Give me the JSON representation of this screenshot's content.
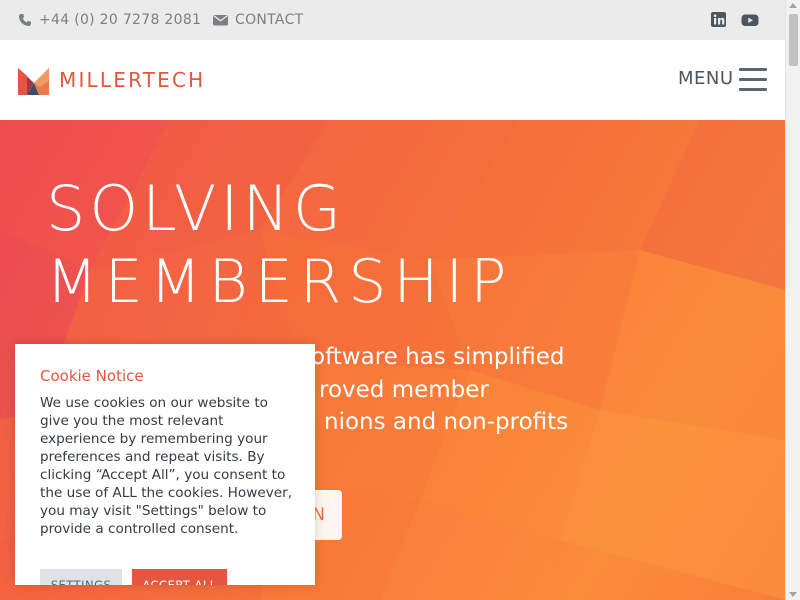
{
  "topbar": {
    "phone_icon": "phone-icon",
    "phone": "+44 (0) 20 7278 2081",
    "contact_icon": "envelope-icon",
    "contact": "CONTACT",
    "social": [
      "linkedin-icon",
      "youtube-icon"
    ]
  },
  "header": {
    "logo_text": "MILLERTECH",
    "menu_label": "MENU",
    "menu_icon": "hamburger-icon"
  },
  "hero": {
    "line1": "SOLVING",
    "line2": "MEMBERSHIP",
    "paragraph": "Our membership software has simplified processes and improved member experience for unions and non-profits",
    "visible_paragraph_fragments": [
      "oftware has simplified",
      "roved member",
      "nions and non-profits"
    ],
    "button_fragment": "N"
  },
  "cookie_notice": {
    "title": "Cookie Notice",
    "body": "We use cookies on our website to give you the most relevant experience by remembering your preferences and repeat visits. By clicking “Accept All”, you consent to the use of ALL the cookies. However, you may visit \"Settings\" below to provide a controlled consent.",
    "settings_label": "SETTINGS",
    "accept_label": "ACCEPT ALL"
  },
  "colors": {
    "brand": "#e4563f",
    "topbar_bg": "#ebebeb",
    "hero_start": "#ee4b4b",
    "hero_end": "#fb8c3a"
  }
}
